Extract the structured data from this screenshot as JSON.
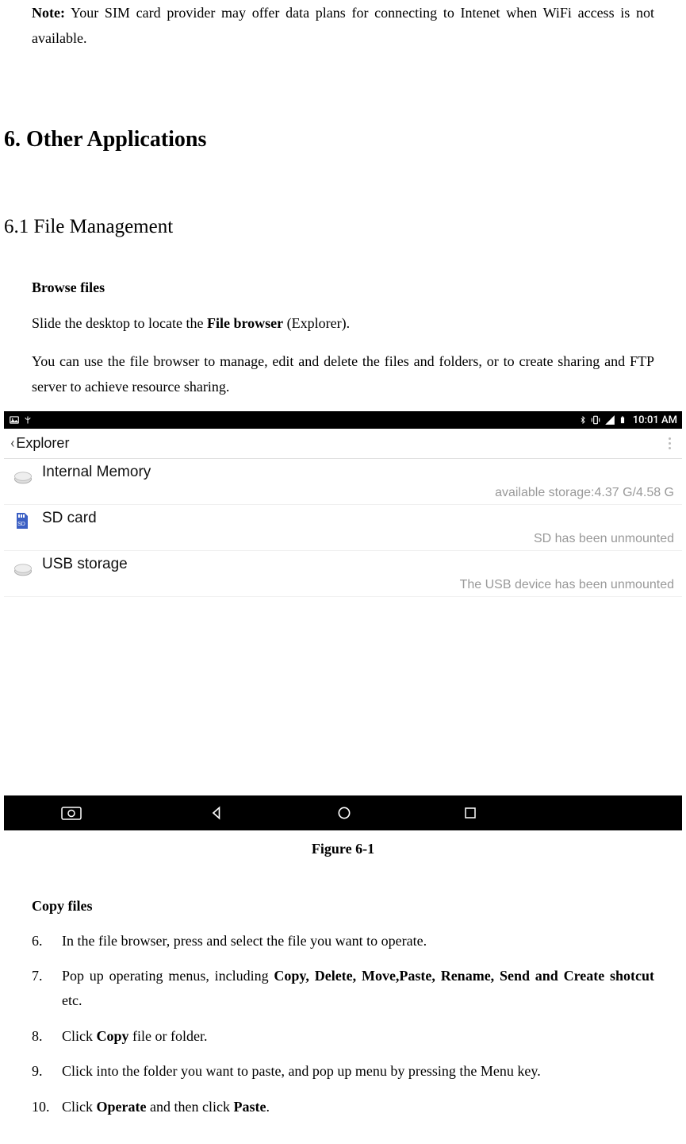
{
  "note": {
    "label": "Note:",
    "text": " Your SIM card provider may offer data plans for connecting to Intenet when WiFi access is not available."
  },
  "section_heading": "6. Other Applications",
  "subsection_heading": "6.1 File Management",
  "browse": {
    "heading": "Browse files",
    "p1_before": "Slide the desktop to locate the ",
    "p1_bold": "File browser",
    "p1_after": " (Explorer).",
    "p2": "You can use the file browser to manage, edit and delete the files and folders, or to create sharing and FTP server to achieve resource sharing."
  },
  "screenshot": {
    "status_time": "10:01 AM",
    "appbar_title": "Explorer",
    "items": [
      {
        "label": "Internal Memory",
        "sub": "available storage:4.37 G/4.58 G"
      },
      {
        "label": "SD card",
        "sub": "SD has been unmounted"
      },
      {
        "label": "USB storage",
        "sub": "The USB device has been unmounted"
      }
    ]
  },
  "figure_caption": "Figure 6-1",
  "copy": {
    "heading": "Copy files",
    "items": [
      {
        "num": "6.",
        "before": "In the file browser, press and select the file you want to operate.",
        "bold": "",
        "after": ""
      },
      {
        "num": "7.",
        "before": "Pop up operating menus, including ",
        "bold": "Copy, Delete, Move,Paste, Rename, Send and Create shotcut",
        "after": " etc."
      },
      {
        "num": "8.",
        "before": "Click ",
        "bold": "Copy",
        "after": " file or folder."
      },
      {
        "num": "9.",
        "before": "Click into the folder you want to paste, and pop up menu by pressing the Menu key.",
        "bold": "",
        "after": ""
      },
      {
        "num": "10.",
        "before": "Click ",
        "bold": "Operate",
        "after": " and then click ",
        "bold2": "Paste",
        "after2": "."
      }
    ]
  }
}
